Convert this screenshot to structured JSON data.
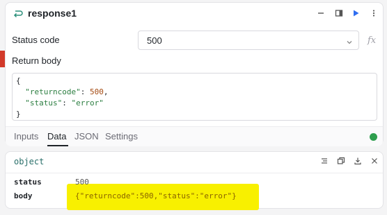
{
  "node": {
    "title": "response1",
    "icon": "return-arrow-icon",
    "actions": [
      "minus-icon",
      "split-view-icon",
      "run-icon",
      "more-icon"
    ]
  },
  "fields": {
    "status_code_label": "Status code",
    "status_code_value": "500",
    "fx_label": "fx",
    "return_body_label": "Return body",
    "body_lines": [
      "{",
      "  \"returncode\": 500,",
      "  \"status\": \"error\"",
      "}"
    ]
  },
  "tabs": [
    {
      "label": "Inputs",
      "active": false
    },
    {
      "label": "Data",
      "active": true
    },
    {
      "label": "JSON",
      "active": false
    },
    {
      "label": "Settings",
      "active": false
    }
  ],
  "output": {
    "title": "object",
    "actions": [
      "list-icon",
      "copy-icon",
      "download-icon",
      "close-icon"
    ],
    "rows": [
      {
        "key": "status",
        "value": "500"
      },
      {
        "key": "body",
        "value": "{\"returncode\":500,\"status\":\"error\"}"
      }
    ]
  },
  "colors": {
    "accent_blue": "#2f6df0",
    "success_green": "#2e9e4e",
    "error_marker": "#d23a2a",
    "highlight_yellow": "#f8f000"
  }
}
